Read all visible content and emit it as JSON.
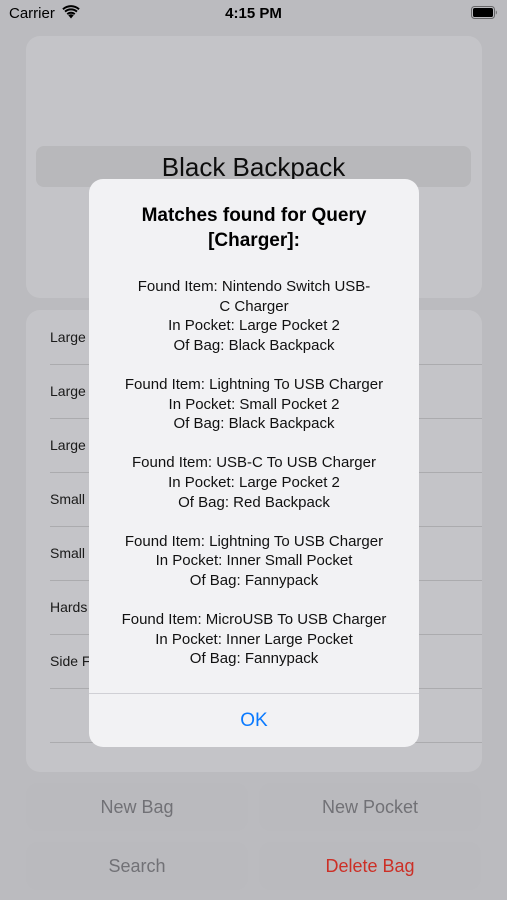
{
  "status_bar": {
    "carrier": "Carrier",
    "time": "4:15 PM",
    "icons": [
      "wifi-icon",
      "battery-icon"
    ]
  },
  "bag": {
    "name": "Black Backpack"
  },
  "pockets": [
    "Large",
    "Large",
    "Large",
    "Small",
    "Small",
    "Hards",
    "Side F"
  ],
  "buttons": {
    "new_bag": "New Bag",
    "new_pocket": "New Pocket",
    "search": "Search",
    "delete_bag": "Delete Bag"
  },
  "alert": {
    "title_line1": "Matches found for Query",
    "title_line2": "[Charger]:",
    "matches": [
      {
        "item_line1": "Found Item: Nintendo Switch USB-",
        "item_line2": "C Charger",
        "pocket": "In Pocket: Large Pocket 2",
        "bag": "Of Bag: Black Backpack"
      },
      {
        "item_line1": "Found Item: Lightning To USB Charger",
        "pocket": "In Pocket: Small Pocket 2",
        "bag": "Of Bag: Black Backpack"
      },
      {
        "item_line1": "Found Item: USB-C To USB Charger",
        "pocket": "In Pocket: Large Pocket 2",
        "bag": "Of Bag: Red Backpack"
      },
      {
        "item_line1": "Found Item: Lightning To USB Charger",
        "pocket": "In Pocket: Inner Small Pocket",
        "bag": "Of Bag: Fannypack"
      },
      {
        "item_line1": "Found Item: MicroUSB To USB Charger",
        "pocket": "In Pocket: Inner Large Pocket",
        "bag": "Of Bag: Fannypack"
      }
    ],
    "ok_label": "OK"
  },
  "colors": {
    "accent": "#0a7aff",
    "destructive": "#ff3b30"
  }
}
